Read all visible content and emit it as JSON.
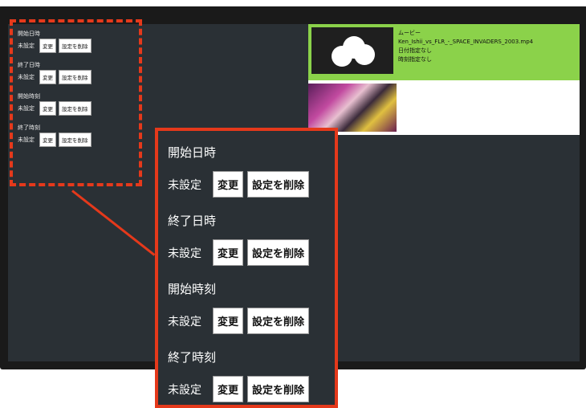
{
  "settings": {
    "groups": [
      {
        "title": "開始日時",
        "status": "未設定",
        "change_label": "変更",
        "delete_label": "設定を削除"
      },
      {
        "title": "終了日時",
        "status": "未設定",
        "change_label": "変更",
        "delete_label": "設定を削除"
      },
      {
        "title": "開始時刻",
        "status": "未設定",
        "change_label": "変更",
        "delete_label": "設定を削除"
      },
      {
        "title": "終了時刻",
        "status": "未設定",
        "change_label": "変更",
        "delete_label": "設定を削除"
      }
    ]
  },
  "media": {
    "selected": {
      "type": "ムービー",
      "filename": "Ken_Ishii_vs_FLR_-_SPACE_INVADERS_2003.mp4",
      "date_note": "日付指定なし",
      "time_note": "時刻指定なし"
    }
  },
  "colors": {
    "highlight": "#e5391b",
    "selected_item": "#8bd24a",
    "screen_bg": "#2a3035"
  }
}
